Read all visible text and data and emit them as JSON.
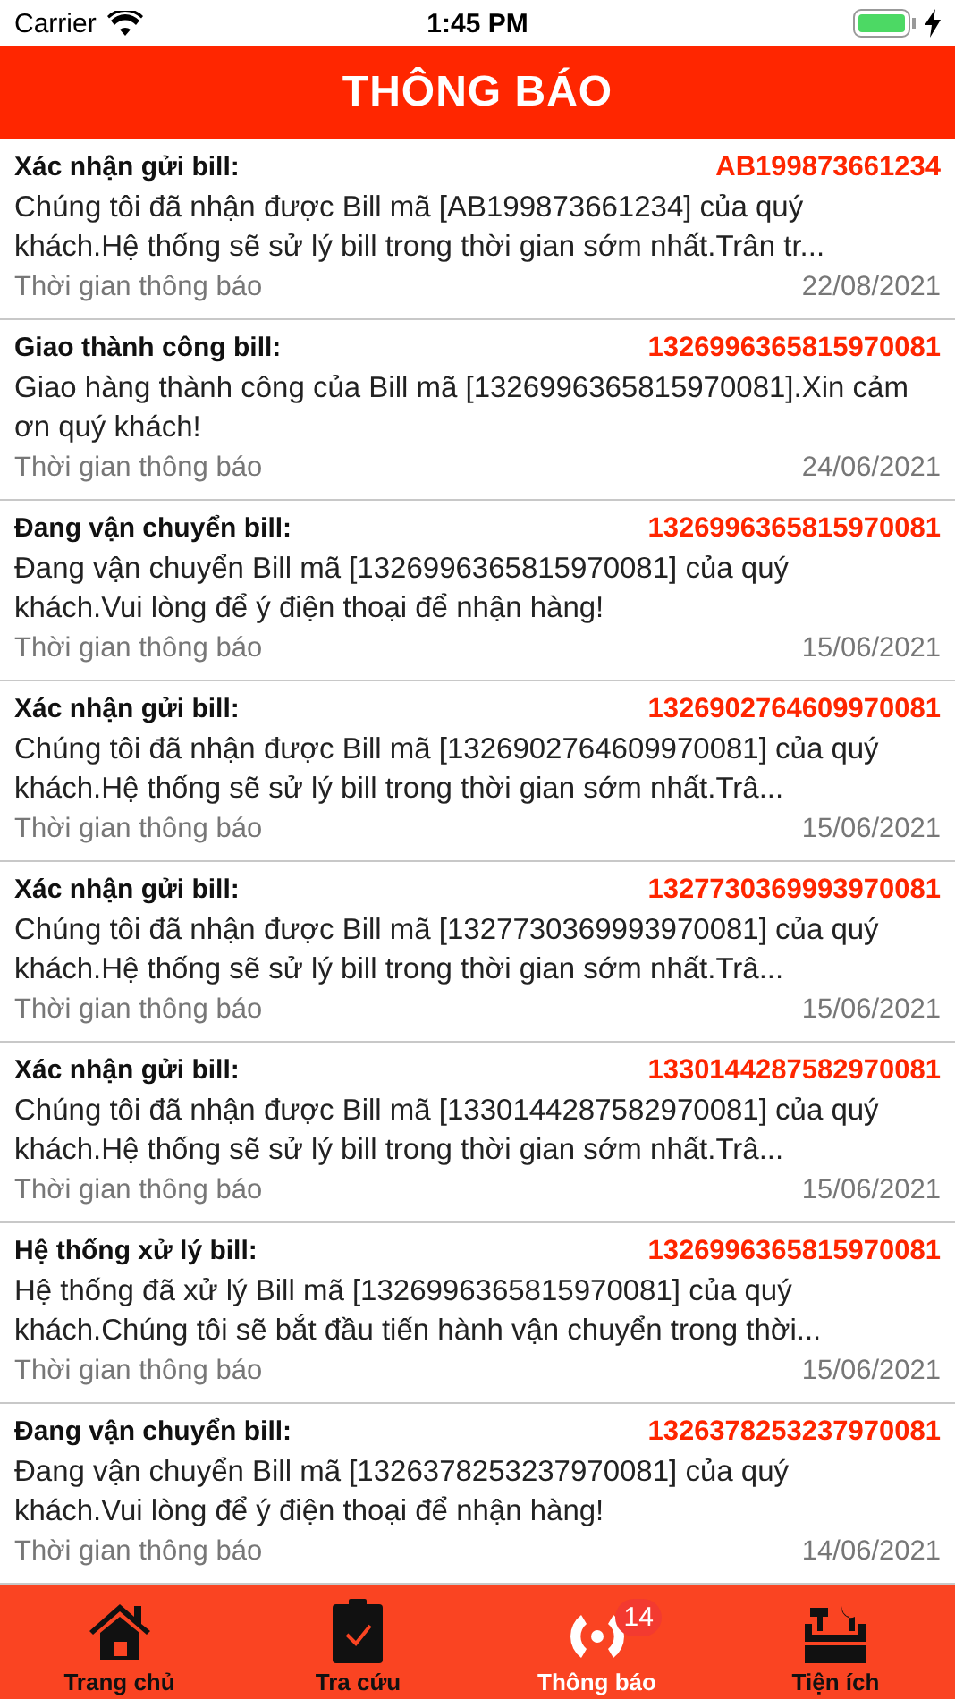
{
  "status_bar": {
    "carrier": "Carrier",
    "time": "1:45 PM"
  },
  "header": {
    "title": "THÔNG BÁO"
  },
  "notifications": [
    {
      "title": "Xác nhận gửi bill:",
      "code": "AB199873661234",
      "message": "Chúng tôi đã nhận được Bill mã [AB199873661234] của quý khách.Hệ thống sẽ sử lý bill trong thời gian sớm nhất.Trân tr...",
      "time_label": "Thời gian thông báo",
      "date": "22/08/2021"
    },
    {
      "title": "Giao thành công bill:",
      "code": "1326996365815970081",
      "message": "Giao hàng thành công của Bill mã [1326996365815970081].Xin cảm ơn quý khách!",
      "time_label": "Thời gian thông báo",
      "date": "24/06/2021"
    },
    {
      "title": "Đang vận chuyển bill:",
      "code": "1326996365815970081",
      "message": "Đang vận chuyển Bill mã [1326996365815970081] của quý khách.Vui lòng để ý điện thoại để nhận hàng!",
      "time_label": "Thời gian thông báo",
      "date": "15/06/2021"
    },
    {
      "title": "Xác nhận gửi bill:",
      "code": "1326902764609970081",
      "message": "Chúng tôi đã nhận được Bill mã [1326902764609970081] của quý khách.Hệ thống sẽ sử lý bill trong thời gian sớm nhất.Trâ...",
      "time_label": "Thời gian thông báo",
      "date": "15/06/2021"
    },
    {
      "title": "Xác nhận gửi bill:",
      "code": "1327730369993970081",
      "message": "Chúng tôi đã nhận được Bill mã [1327730369993970081] của quý khách.Hệ thống sẽ sử lý bill trong thời gian sớm nhất.Trâ...",
      "time_label": "Thời gian thông báo",
      "date": "15/06/2021"
    },
    {
      "title": "Xác nhận gửi bill:",
      "code": "1330144287582970081",
      "message": "Chúng tôi đã nhận được Bill mã [1330144287582970081] của quý khách.Hệ thống sẽ sử lý bill trong thời gian sớm nhất.Trâ...",
      "time_label": "Thời gian thông báo",
      "date": "15/06/2021"
    },
    {
      "title": "Hệ thống xử lý bill:",
      "code": "1326996365815970081",
      "message": "Hệ thống đã xử lý Bill mã [1326996365815970081] của quý khách.Chúng tôi sẽ bắt đầu tiến hành vận chuyển trong thời...",
      "time_label": "Thời gian thông báo",
      "date": "15/06/2021"
    },
    {
      "title": "Đang vận chuyển bill:",
      "code": "1326378253237970081",
      "message": "Đang vận chuyển Bill mã [1326378253237970081] của quý khách.Vui lòng để ý điện thoại để nhận hàng!",
      "time_label": "Thời gian thông báo",
      "date": "14/06/2021"
    }
  ],
  "tabs": [
    {
      "kind": "home",
      "label": "Trang chủ",
      "selected": false
    },
    {
      "kind": "lookup",
      "label": "Tra cứu",
      "selected": false
    },
    {
      "kind": "notifications",
      "label": "Thông báo",
      "selected": true,
      "badge": "14"
    },
    {
      "kind": "utilities",
      "label": "Tiện ích",
      "selected": false
    }
  ]
}
